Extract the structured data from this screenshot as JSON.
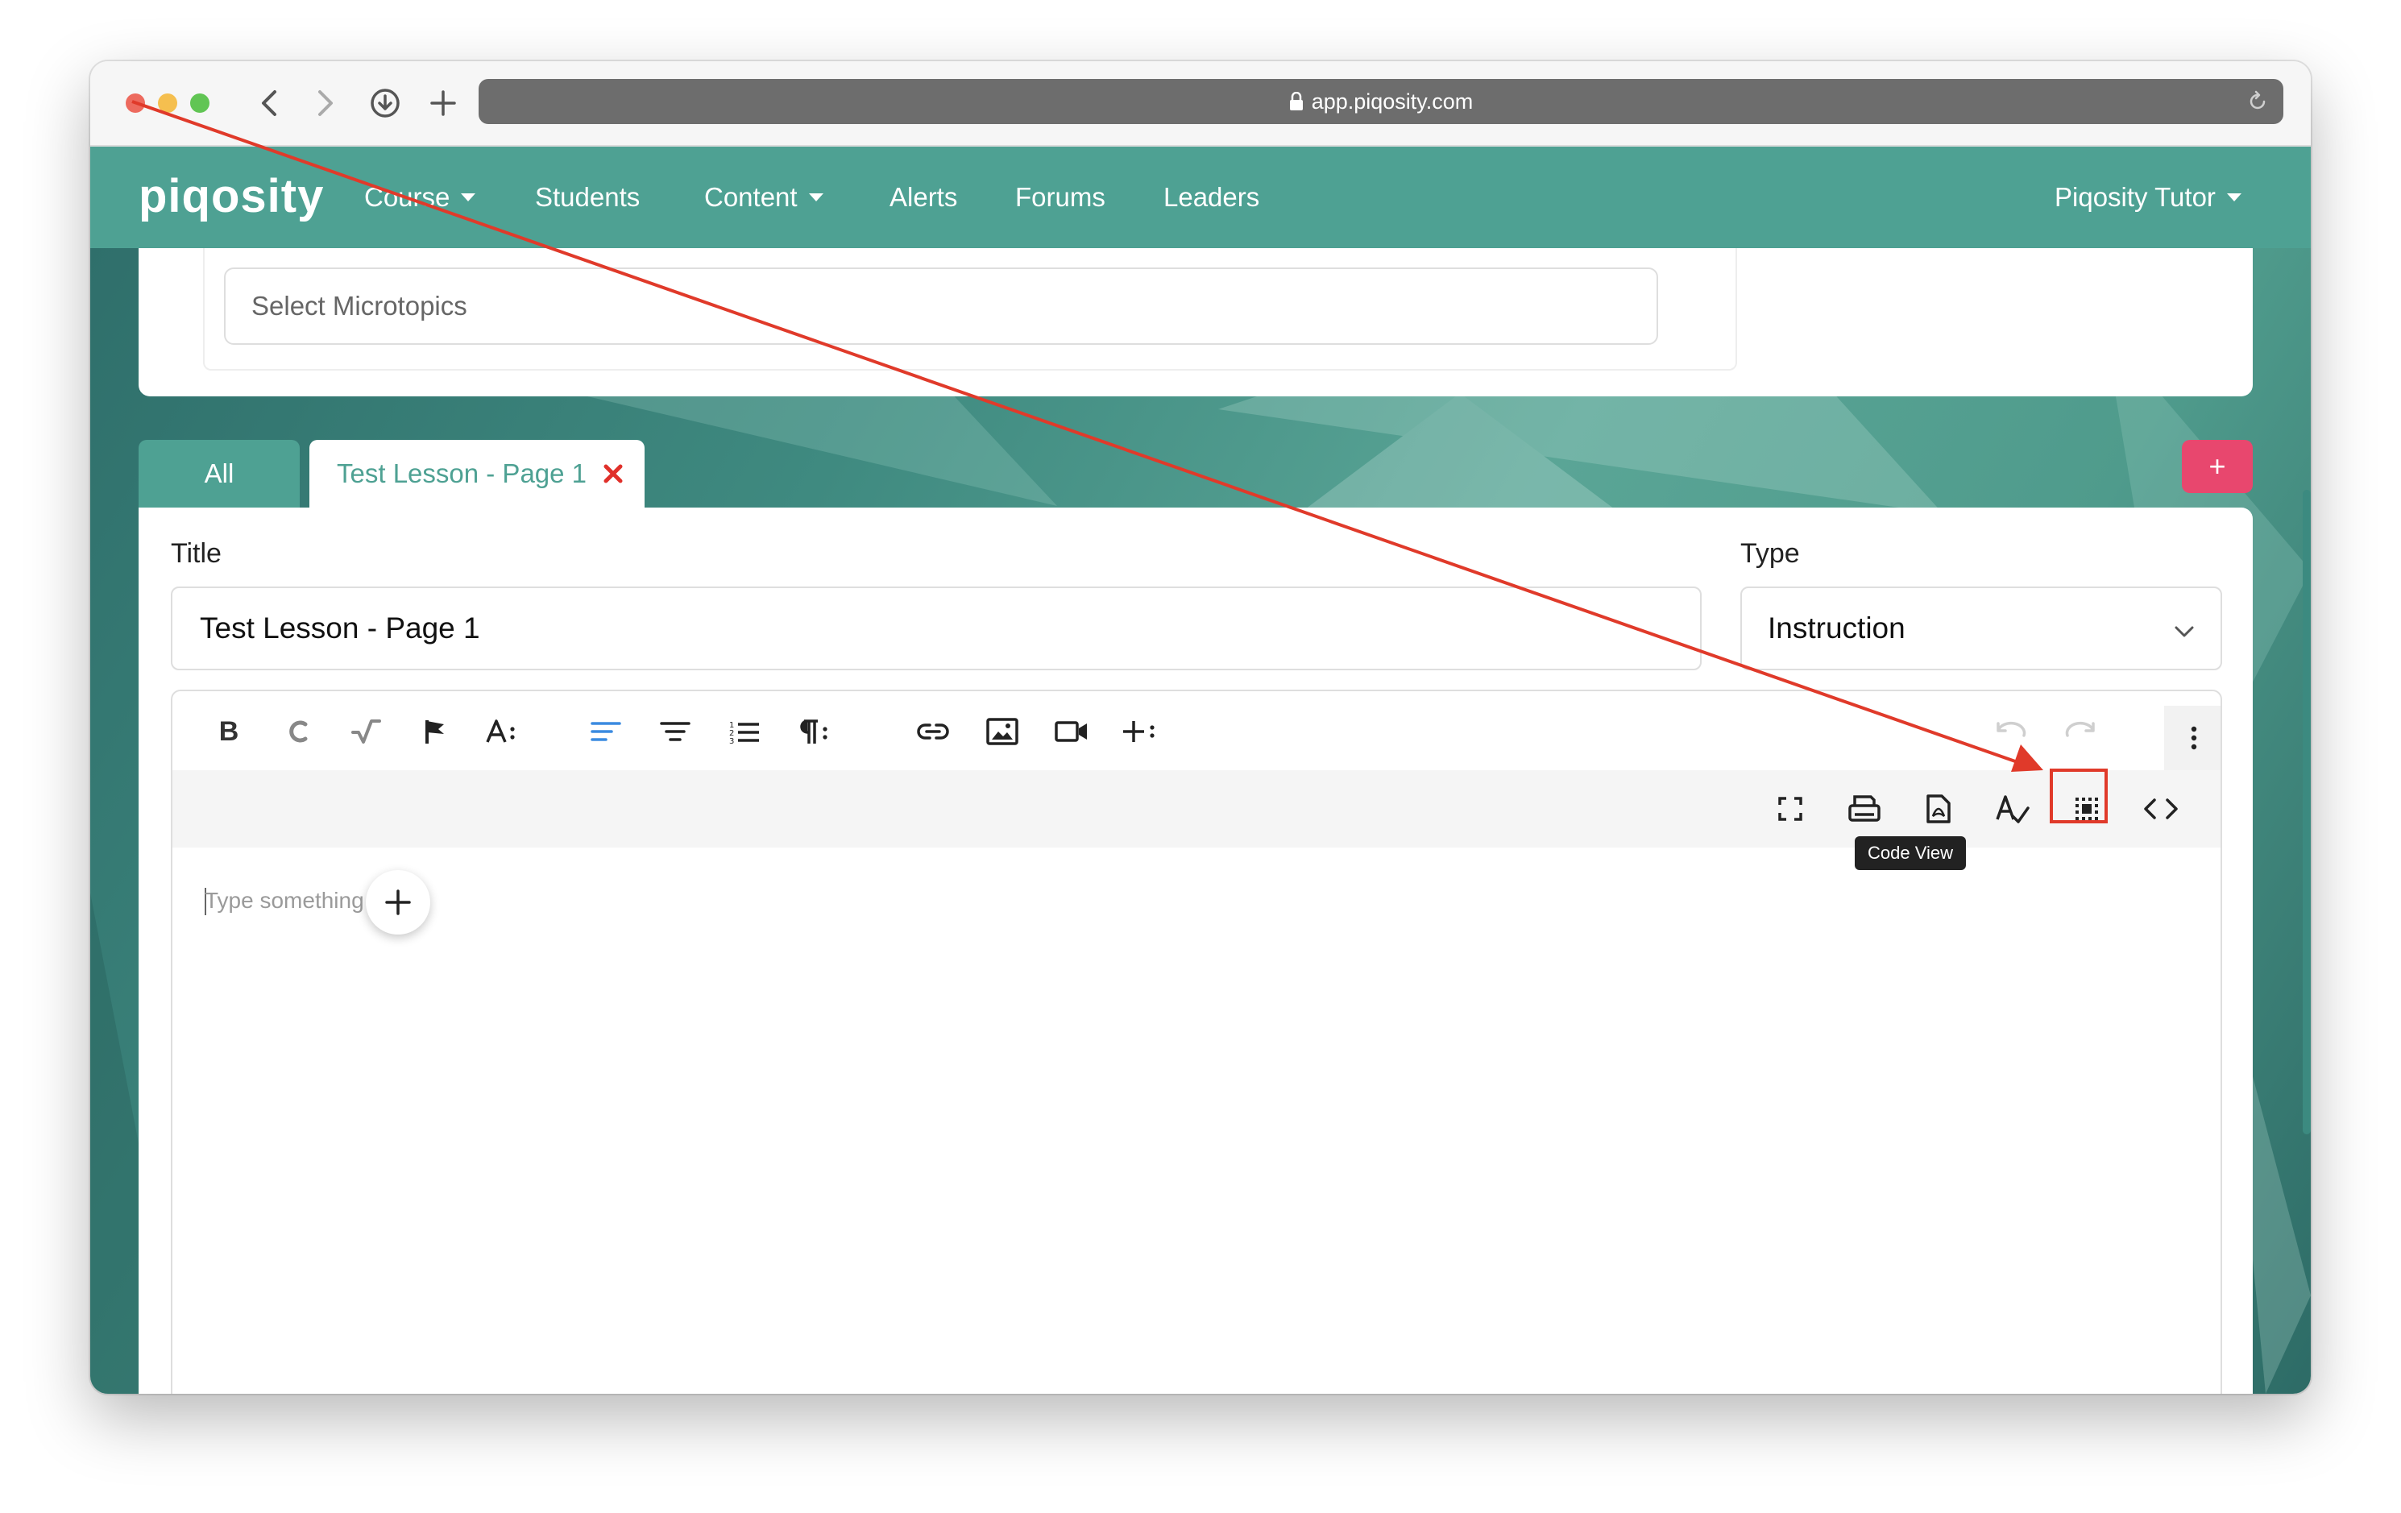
{
  "browser": {
    "url": "app.piqosity.com"
  },
  "navbar": {
    "brand": "piqosity",
    "items": [
      {
        "label": "Course",
        "dropdown": true
      },
      {
        "label": "Students",
        "dropdown": false
      },
      {
        "label": "Content",
        "dropdown": true
      },
      {
        "label": "Alerts",
        "dropdown": false
      },
      {
        "label": "Forums",
        "dropdown": false
      },
      {
        "label": "Leaders",
        "dropdown": false
      }
    ],
    "user_menu": "Piqosity Tutor"
  },
  "microtopics": {
    "placeholder": "Select Microtopics"
  },
  "tabs": {
    "all_label": "All",
    "active_label": "Test Lesson - Page 1",
    "add_label": "+"
  },
  "form": {
    "title_label": "Title",
    "title_value": "Test Lesson - Page 1",
    "type_label": "Type",
    "type_value": "Instruction"
  },
  "editor": {
    "toolbar_primary": [
      "bold-icon",
      "chemistry-icon",
      "math-icon",
      "flag-icon",
      "font-size-icon",
      "align-left-icon",
      "align-center-icon",
      "ordered-list-icon",
      "paragraph-format-icon",
      "link-icon",
      "image-icon",
      "video-icon",
      "insert-more-icon",
      "undo-icon",
      "redo-icon",
      "more-options-icon"
    ],
    "toolbar_secondary": [
      "fullscreen-icon",
      "print-icon",
      "pdf-export-icon",
      "spellcheck-icon",
      "select-all-icon",
      "code-view-icon",
      "help-icon"
    ],
    "help_label": "?",
    "placeholder": "Type something",
    "tooltip": "Code View"
  },
  "colors": {
    "brand": "#4ea193",
    "accent_pink": "#e8476e",
    "annotation_red": "#e03a2a"
  }
}
